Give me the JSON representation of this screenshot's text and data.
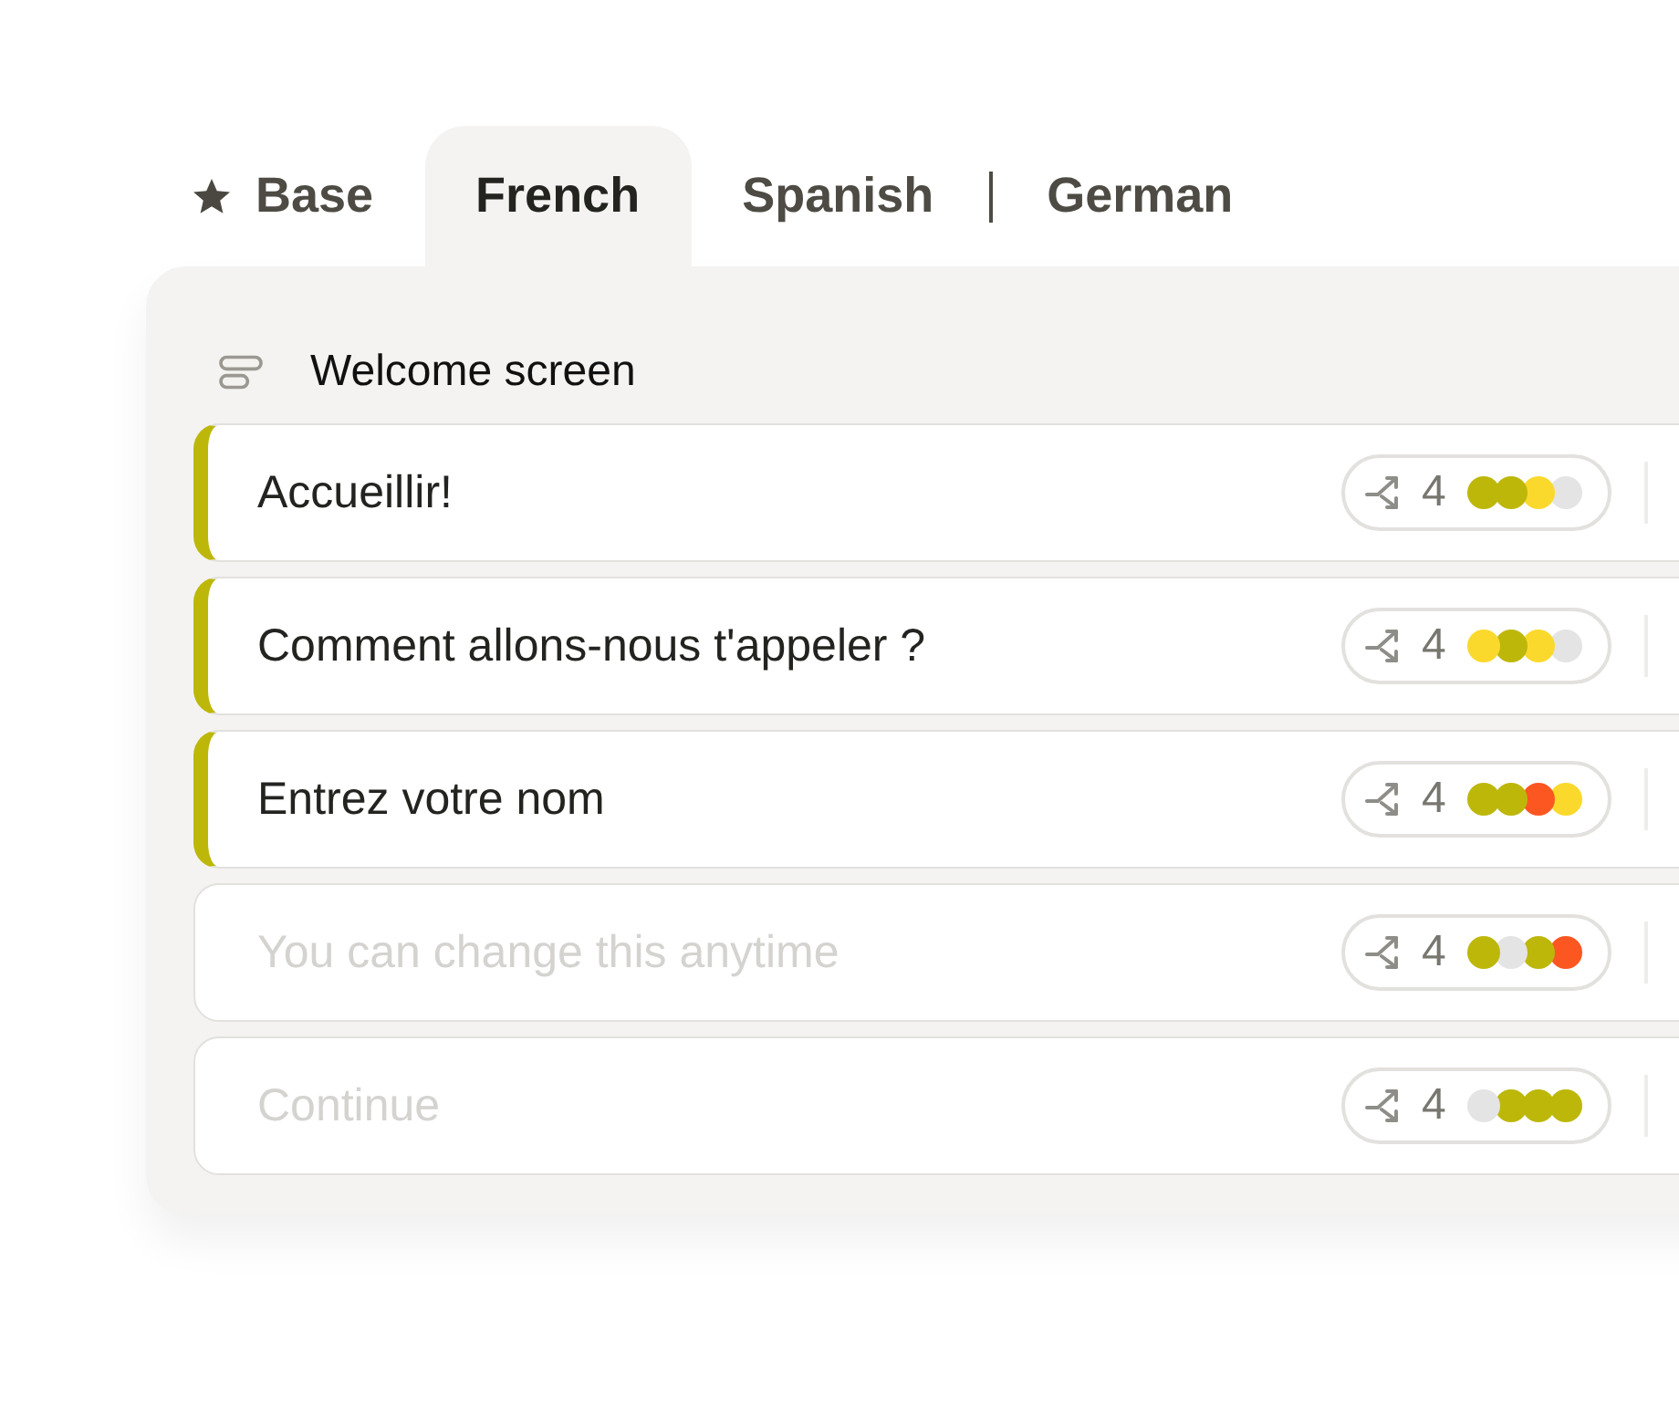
{
  "tabs": [
    {
      "label": "Base",
      "kind": "starred",
      "selected": false
    },
    {
      "label": "French",
      "kind": "plain",
      "selected": true
    },
    {
      "label": "Spanish",
      "kind": "plain",
      "selected": false
    },
    {
      "label": "German",
      "kind": "separated",
      "selected": false
    }
  ],
  "section": {
    "title": "Welcome screen"
  },
  "rows": [
    {
      "text": "Accueillir!",
      "translated": true,
      "count": "4",
      "dots": [
        {
          "color": "#bdb70a"
        },
        {
          "color": "#bdb70a"
        },
        {
          "color": "#fbd92c"
        },
        {
          "color": "#e4e4e4"
        }
      ]
    },
    {
      "text": "Comment allons-nous t'appeler ?",
      "translated": true,
      "count": "4",
      "dots": [
        {
          "color": "#fbd92c"
        },
        {
          "color": "#bdb70a"
        },
        {
          "color": "#fbd92c"
        },
        {
          "color": "#e4e4e4"
        }
      ]
    },
    {
      "text": "Entrez votre nom",
      "translated": true,
      "count": "4",
      "dots": [
        {
          "color": "#bdb70a"
        },
        {
          "color": "#bdb70a"
        },
        {
          "color": "#fc5621"
        },
        {
          "color": "#fbd92c"
        }
      ]
    },
    {
      "text": "You can change this anytime",
      "translated": false,
      "count": "4",
      "dots": [
        {
          "color": "#bdb70a"
        },
        {
          "color": "#e4e4e4"
        },
        {
          "color": "#bdb70a"
        },
        {
          "color": "#fc5621"
        }
      ]
    },
    {
      "text": "Continue",
      "translated": false,
      "count": "4",
      "dots": [
        {
          "color": "#e4e4e4"
        },
        {
          "color": "#bdb70a"
        },
        {
          "color": "#bdb70a"
        },
        {
          "color": "#bdb70a"
        }
      ]
    }
  ]
}
